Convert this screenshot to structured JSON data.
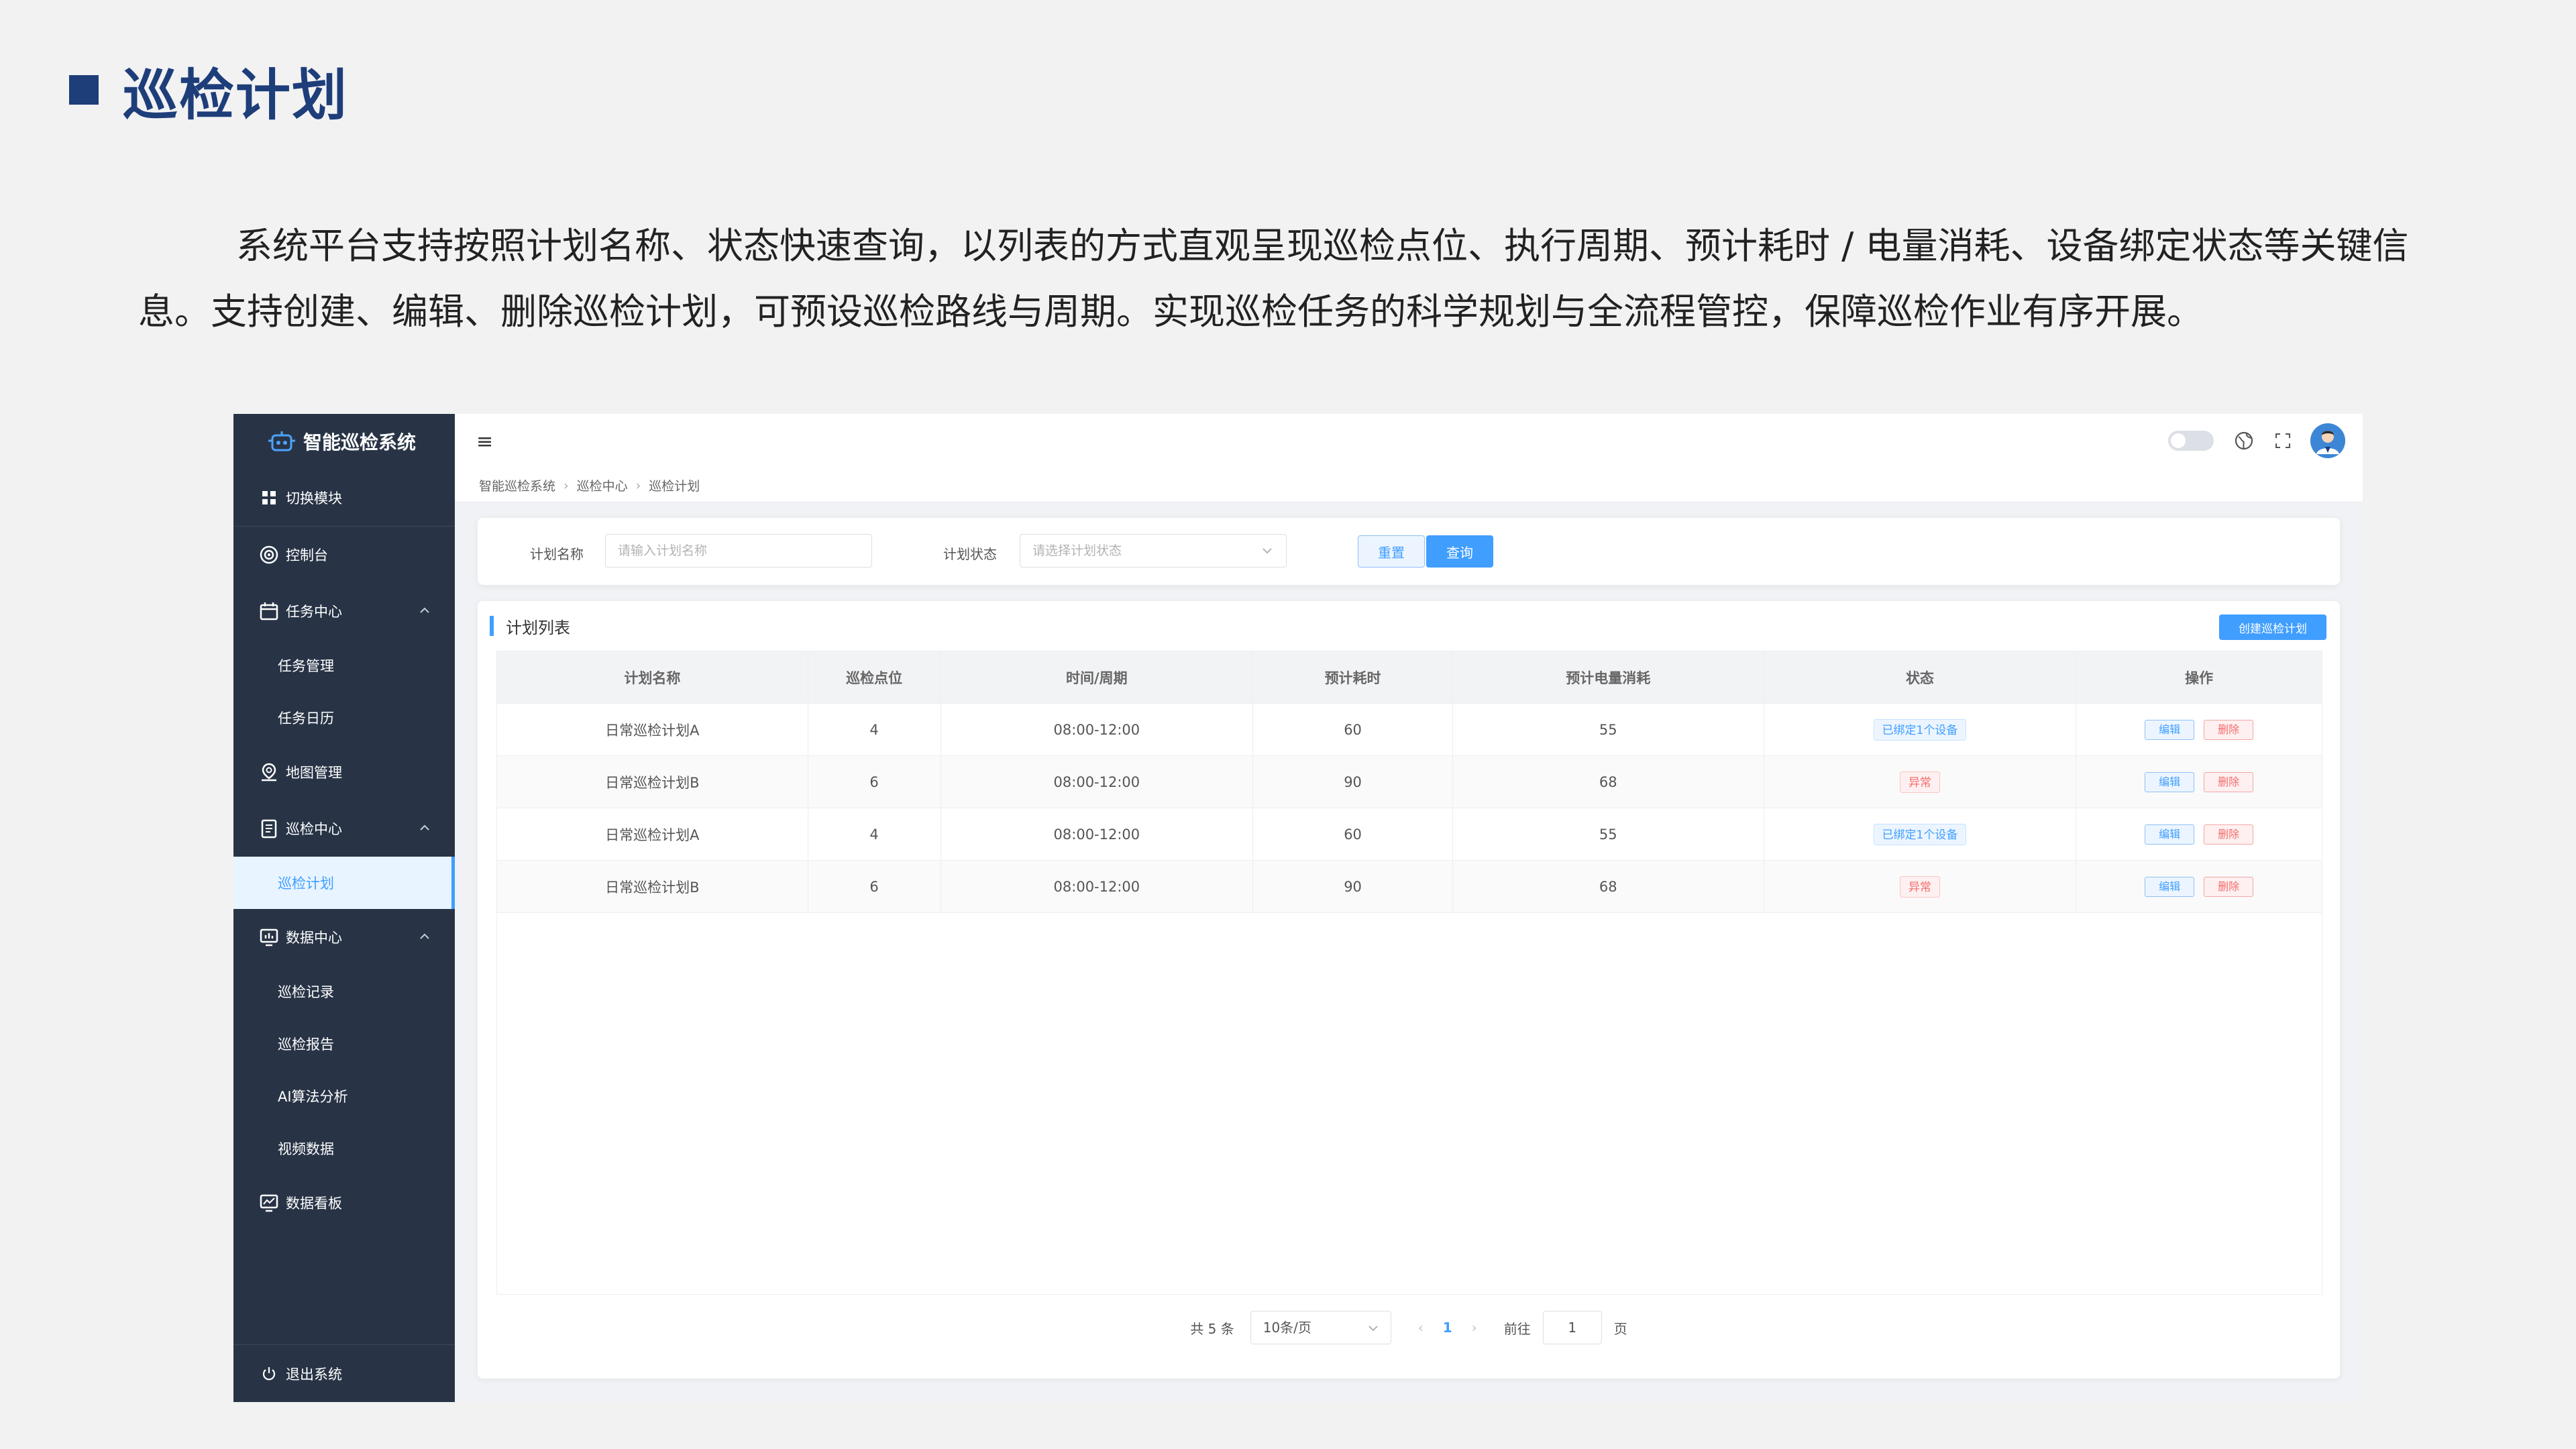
{
  "slide": {
    "title": "巡检计划",
    "description": "系统平台支持按照计划名称、状态快速查询，以列表的方式直观呈现巡检点位、执行周期、预计耗时 / 电量消耗、设备绑定状态等关键信息。支持创建、编辑、删除巡检计划，可预设巡检路线与周期。实现巡检任务的科学规划与全流程管控，保障巡检作业有序开展。"
  },
  "app": {
    "brand": "智能巡检系统",
    "sidebar": {
      "switch_module": "切换模块",
      "items": [
        {
          "label": "控制台"
        },
        {
          "label": "任务中心",
          "children": [
            "任务管理",
            "任务日历"
          ]
        },
        {
          "label": "地图管理"
        },
        {
          "label": "巡检中心",
          "children": [
            "巡检计划"
          ]
        },
        {
          "label": "数据中心",
          "children": [
            "巡检记录",
            "巡检报告",
            "AI算法分析",
            "视频数据"
          ]
        },
        {
          "label": "数据看板"
        }
      ],
      "logout": "退出系统"
    },
    "topbar": {
      "menu_icon": "≡"
    },
    "breadcrumb": [
      "智能巡检系统",
      "巡检中心",
      "巡检计划"
    ],
    "filter": {
      "name_label": "计划名称",
      "name_placeholder": "请输入计划名称",
      "status_label": "计划状态",
      "status_placeholder": "请选择计划状态",
      "reset": "重置",
      "query": "查询"
    },
    "list": {
      "title": "计划列表",
      "create": "创建巡检计划",
      "columns": [
        "计划名称",
        "巡检点位",
        "时间/周期",
        "预计耗时",
        "预计电量消耗",
        "状态",
        "操作"
      ],
      "rows": [
        {
          "name": "日常巡检计划A",
          "points": "4",
          "period": "08:00-12:00",
          "duration": "60",
          "power": "55",
          "status": "已绑定1个设备",
          "status_type": "ok"
        },
        {
          "name": "日常巡检计划B",
          "points": "6",
          "period": "08:00-12:00",
          "duration": "90",
          "power": "68",
          "status": "异常",
          "status_type": "err"
        },
        {
          "name": "日常巡检计划A",
          "points": "4",
          "period": "08:00-12:00",
          "duration": "60",
          "power": "55",
          "status": "已绑定1个设备",
          "status_type": "ok"
        },
        {
          "name": "日常巡检计划B",
          "points": "6",
          "period": "08:00-12:00",
          "duration": "90",
          "power": "68",
          "status": "异常",
          "status_type": "err"
        }
      ],
      "edit": "编辑",
      "delete": "删除"
    },
    "pagination": {
      "total": "共 5 条",
      "page_size": "10条/页",
      "current": "1",
      "goto_label": "前往",
      "goto_value": "1",
      "page_unit": "页"
    }
  }
}
